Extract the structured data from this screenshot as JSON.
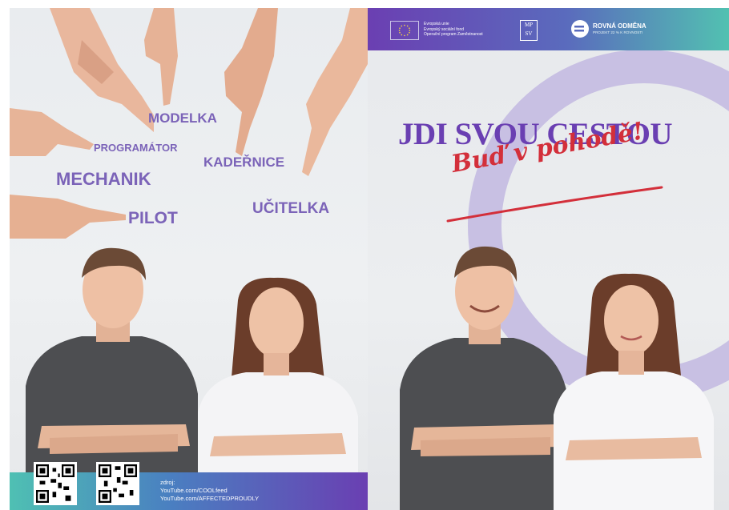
{
  "left_panel": {
    "words": {
      "modelka": "MODELKA",
      "programator": "PROGRAMÁTOR",
      "kadernice": "KADEŘNICE",
      "mechanik": "MECHANIK",
      "ucitelka": "UČITELKA",
      "pilot": "PILOT"
    },
    "source": {
      "label": "zdroj:",
      "line1": "YouTube.com/COOLfeed",
      "line2": "YouTube.com/AFFECTEDPROUDLY"
    }
  },
  "right_panel": {
    "header": {
      "eu_line1": "Evropská unie",
      "eu_line2": "Evropský sociální fond",
      "eu_line3": "Operační program Zaměstnanost",
      "mpsv_line1": "MP",
      "mpsv_line2": "SV",
      "project_title": "ROVNÁ ODMĚNA",
      "project_subtitle": "PROJEKT 22 % K ROVNOSTI"
    },
    "headline": "JDI SVOU CESTOU",
    "tagline": "Buď v pohodě!"
  },
  "colors": {
    "purple": "#6a3fb2",
    "teal": "#52c1b1",
    "red": "#d32f3a",
    "ring": "#c8c0e3",
    "word": "#7b63b8"
  },
  "icons": [
    "eu-flag-icon",
    "mpsv-logo-icon",
    "rovna-odmena-logo-icon",
    "qr-code-icon"
  ]
}
